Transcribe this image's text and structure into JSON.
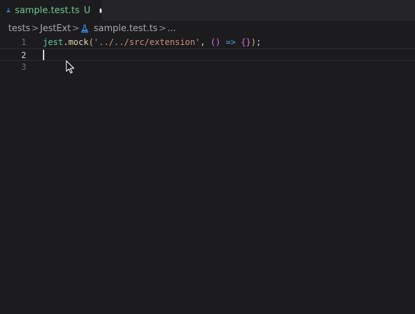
{
  "tab": {
    "label": "sample.test.ts",
    "status": "U",
    "icon": "flask-icon"
  },
  "breadcrumb": {
    "items": [
      "tests",
      "JestExt",
      "sample.test.ts",
      "..."
    ],
    "separator": ">"
  },
  "editor": {
    "line_numbers": [
      "1",
      "2",
      "3"
    ],
    "active_line": 2,
    "line1": {
      "jest": "jest",
      "dot": ".",
      "mock": "mock",
      "open_paren": "(",
      "string": "'../../src/extension'",
      "comma": ", ",
      "arrow_params": "()",
      "arrow": " => ",
      "braces": "{}",
      "close_paren": ")",
      "semi": ";"
    }
  },
  "colors": {
    "background": "#1c1c1f",
    "tab_label": "#73c991",
    "string": "#ce9178",
    "keyword": "#569cd6"
  }
}
